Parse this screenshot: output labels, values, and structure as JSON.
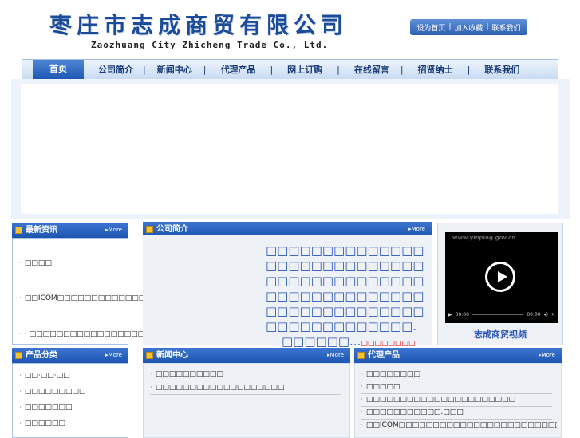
{
  "header": {
    "logo_cn": "枣庄市志成商贸有限公司",
    "logo_en": "Zaozhuang City Zhicheng Trade Co., Ltd.",
    "toplinks": [
      "设为首页",
      "加入收藏",
      "联系我们"
    ]
  },
  "nav": [
    "首页",
    "公司简介",
    "新闻中心",
    "代理产品",
    "网上订购",
    "在线留言",
    "招贤纳士",
    "联系我们"
  ],
  "latest": {
    "title": "最新资讯",
    "more": "More",
    "items": [
      "□□□□",
      "□□ICOM□□□□□□□□□□□□□□...",
      "□□□□□□□□□□□□□□□□□□"
    ]
  },
  "about": {
    "title": "公司简介",
    "more": "More",
    "text": "□□□□□□□□□□□□□□□□□□□□□□□□□□□□□□□□□□□□□□□□□□□□□□□□□□□□□□□□□□□□□□□□□□□□□□□□□□□□□□□□□□□.",
    "text2": "□□□□□□...",
    "more_link": "□□□□□□□□"
  },
  "video": {
    "watermark": "www.yinping.gov.cn",
    "time_left": "00:00",
    "time_right": "00:00",
    "caption": "志成商贸视频"
  },
  "categories": {
    "title": "产品分类",
    "more": "More",
    "items": [
      "□□·□□·□□",
      "□□□□□□□□□",
      "□□□□□□□",
      "□□□□□□"
    ]
  },
  "news": {
    "title": "新闻中心",
    "more": "More",
    "items": [
      "□□□□□□□□□□",
      "□□□□□□□□□□□□□□□□□□□"
    ]
  },
  "products": {
    "title": "代理产品",
    "more": "More",
    "items": [
      "□□□□□□□□",
      "□□□□□",
      "□□□□□□□□□□□□□□□□□□□□□□",
      "□□□□□□□□□□□.□□□",
      "□□ICOM□□□□□□□□□□□□□□□□□□□□□□□□□□□□□□□□□"
    ]
  }
}
